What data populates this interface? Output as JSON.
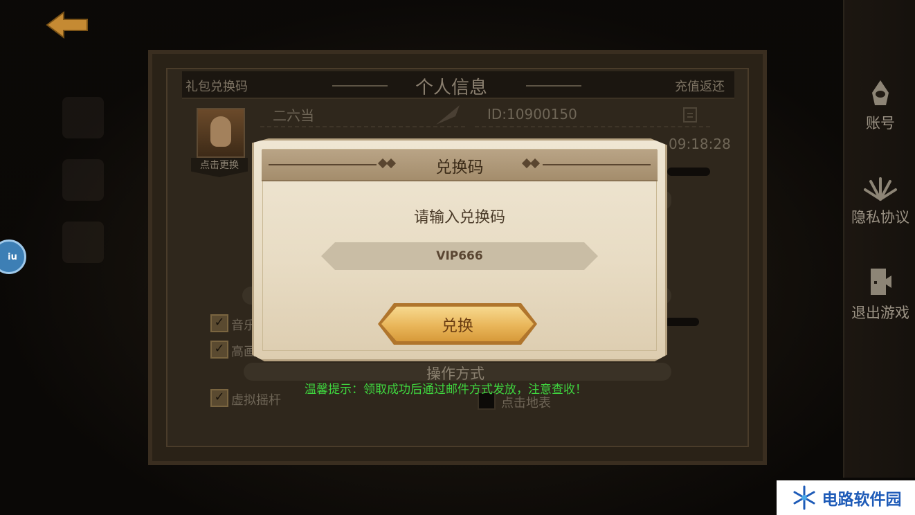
{
  "page": {
    "back_icon": "arrow-left-icon"
  },
  "right_menu": {
    "items": [
      {
        "label": "账号",
        "icon": "hooded-figure-icon"
      },
      {
        "label": "隐私协议",
        "icon": "sunburst-icon"
      },
      {
        "label": "退出游戏",
        "icon": "exit-door-icon"
      }
    ]
  },
  "float_ball": {
    "label": "iu"
  },
  "profile_panel": {
    "left_tab": "礼包兑换码",
    "title": "个人信息",
    "right_tab": "充值返还",
    "player_name": "二六当",
    "player_id": "ID:10900150",
    "avatar_label": "点击更换",
    "time": "09:18:28",
    "operation_mode": "操作方式",
    "options": {
      "music": {
        "label": "音乐",
        "checked": true
      },
      "hd": {
        "label": "高画",
        "checked": true
      },
      "joystick": {
        "label": "虚拟摇杆",
        "checked": true
      },
      "tap_ground": {
        "label": "点击地表",
        "checked": false
      }
    }
  },
  "dialog": {
    "title": "兑换码",
    "prompt": "请输入兑换码",
    "code_value": "VIP666",
    "redeem_label": "兑换"
  },
  "tip": "温馨提示：领取成功后通过邮件方式发放，注意查收！",
  "watermark": {
    "text": "电路软件园"
  },
  "colors": {
    "tip_green": "#3fd63f",
    "button_gold": "#e9b65a",
    "paper": "#efe6d3"
  }
}
